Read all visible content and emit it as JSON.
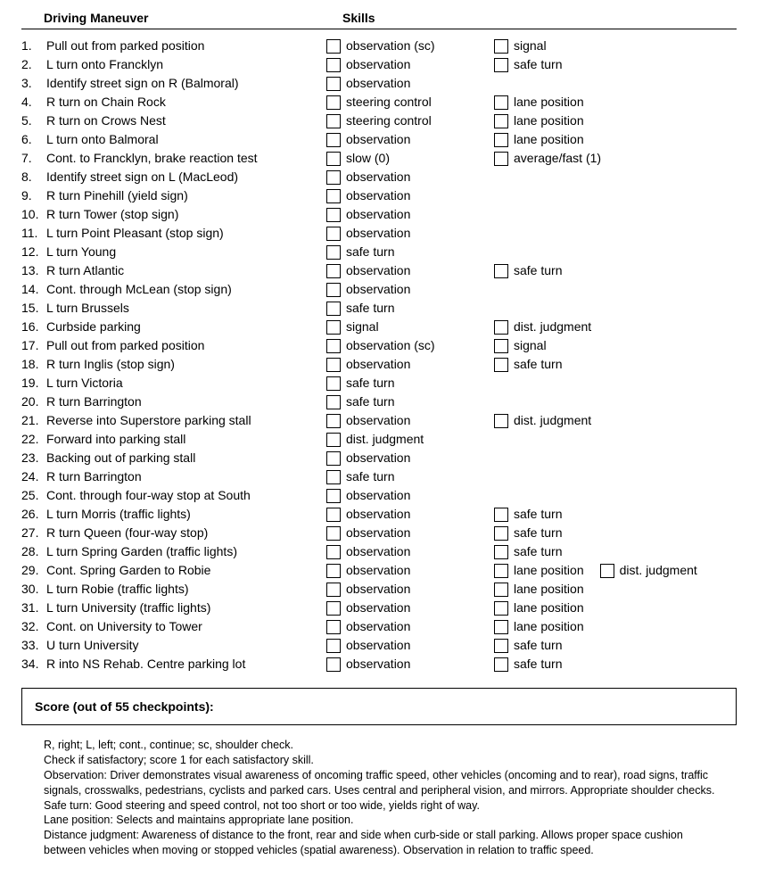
{
  "header": {
    "maneuver": "Driving Maneuver",
    "skills": "Skills"
  },
  "rows": [
    {
      "n": "1.",
      "m": "Pull out from parked position",
      "s": [
        "observation (sc)",
        "signal"
      ]
    },
    {
      "n": "2.",
      "m": "L turn onto Francklyn",
      "s": [
        "observation",
        "safe turn"
      ]
    },
    {
      "n": "3.",
      "m": "Identify street sign on R (Balmoral)",
      "s": [
        "observation"
      ]
    },
    {
      "n": "4.",
      "m": "R turn on Chain Rock",
      "s": [
        "steering control",
        "lane position"
      ]
    },
    {
      "n": "5.",
      "m": "R turn on Crows Nest",
      "s": [
        "steering control",
        "lane position"
      ]
    },
    {
      "n": "6.",
      "m": "L turn onto Balmoral",
      "s": [
        "observation",
        "lane position"
      ]
    },
    {
      "n": "7.",
      "m": "Cont. to Francklyn, brake reaction test",
      "s": [
        "slow (0)",
        "average/fast (1)"
      ]
    },
    {
      "n": "8.",
      "m": "Identify street sign on L (MacLeod)",
      "s": [
        "observation"
      ]
    },
    {
      "n": "9.",
      "m": "R turn Pinehill (yield sign)",
      "s": [
        "observation"
      ]
    },
    {
      "n": "10.",
      "m": "R turn Tower (stop sign)",
      "s": [
        "observation"
      ]
    },
    {
      "n": "11.",
      "m": "L turn Point Pleasant (stop sign)",
      "s": [
        "observation"
      ]
    },
    {
      "n": "12.",
      "m": "L turn Young",
      "s": [
        "safe turn"
      ]
    },
    {
      "n": "13.",
      "m": "R turn Atlantic",
      "s": [
        "observation",
        "safe turn"
      ]
    },
    {
      "n": "14.",
      "m": "Cont. through McLean (stop sign)",
      "s": [
        "observation"
      ]
    },
    {
      "n": "15.",
      "m": "L turn Brussels",
      "s": [
        "safe turn"
      ]
    },
    {
      "n": "16.",
      "m": "Curbside parking",
      "s": [
        "signal",
        "dist. judgment"
      ]
    },
    {
      "n": "17.",
      "m": "Pull out from parked position",
      "s": [
        "observation (sc)",
        "signal"
      ]
    },
    {
      "n": "18.",
      "m": "R turn Inglis (stop sign)",
      "s": [
        "observation",
        "safe turn"
      ]
    },
    {
      "n": "19.",
      "m": "L turn Victoria",
      "s": [
        "safe turn"
      ]
    },
    {
      "n": "20.",
      "m": "R turn Barrington",
      "s": [
        "safe turn"
      ]
    },
    {
      "n": "21.",
      "m": "Reverse into Superstore parking stall",
      "s": [
        "observation",
        "dist. judgment"
      ]
    },
    {
      "n": "22.",
      "m": "Forward into parking stall",
      "s": [
        "dist. judgment"
      ]
    },
    {
      "n": "23.",
      "m": "Backing out of parking stall",
      "s": [
        "observation"
      ]
    },
    {
      "n": "24.",
      "m": "R turn Barrington",
      "s": [
        "safe turn"
      ]
    },
    {
      "n": "25.",
      "m": "Cont. through four-way stop at South",
      "s": [
        "observation"
      ]
    },
    {
      "n": "26.",
      "m": "L turn Morris (traffic lights)",
      "s": [
        "observation",
        "safe turn"
      ]
    },
    {
      "n": "27.",
      "m": "R turn Queen (four-way stop)",
      "s": [
        "observation",
        "safe turn"
      ]
    },
    {
      "n": "28.",
      "m": "L turn Spring Garden (traffic lights)",
      "s": [
        "observation",
        "safe turn"
      ]
    },
    {
      "n": "29.",
      "m": "Cont. Spring Garden to Robie",
      "s": [
        "observation",
        "lane position",
        "dist. judgment"
      ]
    },
    {
      "n": "30.",
      "m": "L turn Robie (traffic lights)",
      "s": [
        "observation",
        "lane position"
      ]
    },
    {
      "n": "31.",
      "m": "L turn University (traffic lights)",
      "s": [
        "observation",
        "lane position"
      ]
    },
    {
      "n": "32.",
      "m": "Cont. on University to Tower",
      "s": [
        "observation",
        "lane position"
      ]
    },
    {
      "n": "33.",
      "m": "U turn University",
      "s": [
        "observation",
        "safe turn"
      ]
    },
    {
      "n": "34.",
      "m": "R into NS Rehab. Centre parking lot",
      "s": [
        "observation",
        "safe turn"
      ]
    }
  ],
  "score_label": "Score (out of 55 checkpoints):",
  "notes": [
    "R, right; L, left; cont., continue; sc, shoulder check.",
    "Check if satisfactory; score 1 for each satisfactory skill.",
    "Observation: Driver demonstrates visual awareness of oncoming traffic speed, other vehicles (oncoming and to rear), road signs, traffic signals, crosswalks, pedestrians, cyclists and parked cars. Uses central and peripheral vision, and mirrors. Appropriate shoulder checks.",
    "Safe turn: Good steering and speed control, not too short or too wide, yields right of way.",
    "Lane position: Selects and maintains appropriate lane position.",
    "Distance judgment: Awareness of distance to the front, rear and side when curb-side or stall parking. Allows proper space cushion between vehicles when moving or stopped vehicles (spatial awareness). Observation in relation to traffic speed."
  ]
}
